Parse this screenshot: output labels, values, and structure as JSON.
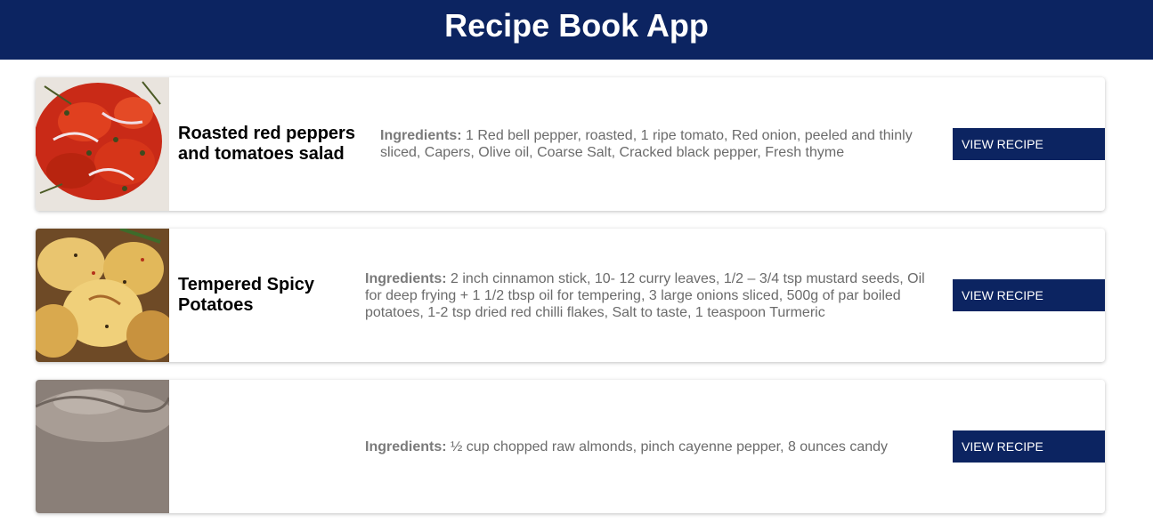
{
  "app": {
    "title": "Recipe Book App"
  },
  "ingredients_label": "Ingredients:",
  "recipes": [
    {
      "title": "Roasted red peppers and tomatoes salad",
      "ingredients": "1 Red bell pepper, roasted, 1 ripe tomato, Red onion, peeled and thinly sliced, Capers, Olive oil, Coarse Salt, Cracked black pepper, Fresh thyme",
      "button_label": "VIEW RECIPE"
    },
    {
      "title": "Tempered Spicy Potatoes",
      "ingredients": "2 inch cinnamon stick, 10- 12 curry leaves, 1/2 – 3/4 tsp mustard seeds, Oil for deep frying + 1 1/2 tbsp oil for tempering, 3 large onions sliced, 500g of par boiled potatoes, 1-2 tsp dried red chilli flakes, Salt to taste, 1 teaspoon Turmeric",
      "button_label": "VIEW RECIPE"
    },
    {
      "title": "",
      "ingredients": "½ cup chopped raw almonds, pinch cayenne pepper, 8 ounces candy",
      "button_label": "VIEW RECIPE"
    }
  ],
  "colors": {
    "header_bg": "#0c2461",
    "button_bg": "#0c2461"
  }
}
